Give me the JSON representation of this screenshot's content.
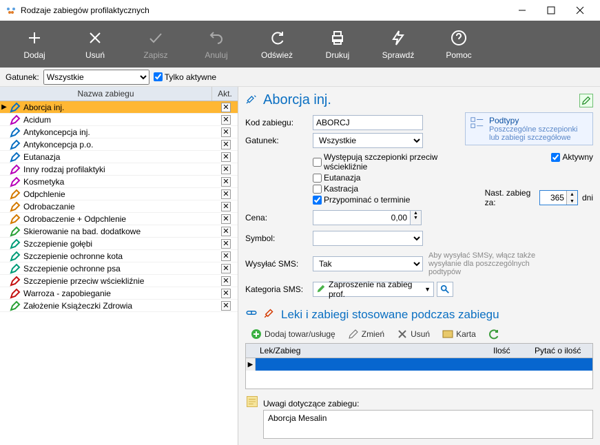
{
  "window": {
    "title": "Rodzaje zabiegów profilaktycznych"
  },
  "toolbar": {
    "add": "Dodaj",
    "delete": "Usuń",
    "save": "Zapisz",
    "cancel": "Anuluj",
    "refresh": "Odśwież",
    "print": "Drukuj",
    "check": "Sprawdź",
    "help": "Pomoc"
  },
  "filter": {
    "label": "Gatunek:",
    "value": "Wszystkie",
    "only_active": "Tylko aktywne"
  },
  "grid": {
    "col_name": "Nazwa zabiegu",
    "col_akt": "Akt.",
    "rows": [
      {
        "name": "Aborcja inj.",
        "color": "#0a6fc2",
        "selected": true
      },
      {
        "name": "Acidum",
        "color": "#b800b8"
      },
      {
        "name": "Antykoncepcja inj.",
        "color": "#0a6fc2"
      },
      {
        "name": "Antykoncepcja p.o.",
        "color": "#0a6fc2"
      },
      {
        "name": "Eutanazja",
        "color": "#0a6fc2"
      },
      {
        "name": "Inny rodzaj profilaktyki",
        "color": "#b800b8"
      },
      {
        "name": "Kosmetyka",
        "color": "#b800b8"
      },
      {
        "name": "Odpchlenie",
        "color": "#d47a00"
      },
      {
        "name": "Odrobaczanie",
        "color": "#d47a00"
      },
      {
        "name": "Odrobaczenie + Odpchlenie",
        "color": "#d47a00"
      },
      {
        "name": "Skierowanie na bad. dodatkowe",
        "color": "#2aa036"
      },
      {
        "name": "Szczepienie gołębi",
        "color": "#009c78"
      },
      {
        "name": "Szczepienie ochronne kota",
        "color": "#009c78"
      },
      {
        "name": "Szczepienie ochronne psa",
        "color": "#009c78"
      },
      {
        "name": "Szczepienie przeciw wściekliźnie",
        "color": "#c41212"
      },
      {
        "name": "Warroza - zapobieganie",
        "color": "#c41212"
      },
      {
        "name": "Założenie Książeczki Zdrowia",
        "color": "#2aa036"
      }
    ]
  },
  "detail": {
    "title": "Aborcja inj.",
    "kod_label": "Kod zabiegu:",
    "kod_value": "ABORCJ",
    "gatunek_label": "Gatunek:",
    "gatunek_value": "Wszystkie",
    "subtypes_title": "Podtypy",
    "subtypes_sub": "Poszczególne szczepionki lub zabiegi szczegółowe",
    "chk_rabies": "Występują szczepionki przeciw wściekliźnie",
    "chk_eutanazja": "Eutanazja",
    "chk_kastracja": "Kastracja",
    "chk_remind": "Przypominać o terminie",
    "chk_active": "Aktywny",
    "next_label": "Nast. zabieg za:",
    "next_value": "365",
    "next_unit": "dni",
    "cena_label": "Cena:",
    "cena_value": "0,00",
    "symbol_label": "Symbol:",
    "sms_label": "Wysyłać SMS:",
    "sms_value": "Tak",
    "sms_hint": "Aby wysyłać SMSy, włącz także wysyłanie dla poszczególnych podtypów",
    "smscat_label": "Kategoria SMS:",
    "smscat_value": "Zaproszenie na zabieg prof."
  },
  "meds": {
    "section_title": "Leki i zabiegi stosowane podczas zabiegu",
    "add": "Dodaj towar/usługę",
    "edit": "Zmień",
    "del": "Usuń",
    "card": "Karta",
    "col_item": "Lek/Zabieg",
    "col_qty": "Ilość",
    "col_ask": "Pytać o ilość"
  },
  "notes": {
    "label": "Uwagi dotyczące zabiegu:",
    "value": "Aborcja Mesalin"
  }
}
